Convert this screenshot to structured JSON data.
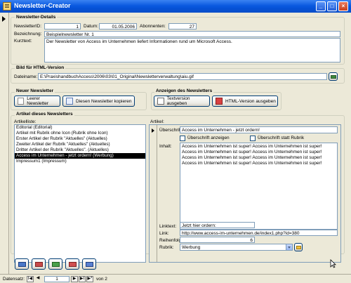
{
  "window": {
    "title": "Newsletter-Creator"
  },
  "details": {
    "section_label": "Newsletter-Details",
    "id_label": "NewsletterID:",
    "id_value": "1",
    "date_label": "Datum:",
    "date_value": "01.05.2006",
    "subscribers_label": "Abonnenten:",
    "subscribers_value": "27",
    "name_label": "Bezeichnung:",
    "name_value": "Beispielnewsletter Nr. 1",
    "short_label": "Kurztext:",
    "short_value": "Der Newsletter von Access im Unternehmen liefert Informationen rund um Microsoft Access."
  },
  "html_image": {
    "section_label": "Bild für HTML-Version",
    "file_label": "Dateiname:",
    "file_value": "E:\\PraxishandbuchAccess\\2006\\03\\01_Original\\Newsletterverwaltung\\aiu.gif"
  },
  "new_newsletter": {
    "section_label": "Neuer Newsletter",
    "empty_button": "Leerer Newsletter",
    "copy_button": "Diesen Newsletter kopieren"
  },
  "show_newsletter": {
    "section_label": "Anzeigen des Newsletters",
    "text_button": "Textversion ausgeben",
    "html_button": "HTML-Version ausgeben"
  },
  "articles": {
    "section_label": "Artikel dieses Newsletters",
    "list_label": "Artikelliste:",
    "items": [
      "Editorial (Editorial)",
      "Artikel mit Rubrik ohne Icon (Rubrik ohne Icon)",
      "Erster Artikel der Rubrik \"Aktuelles\" (Aktuelles)",
      "Zweiter Artikel der Rubrik \"Aktuelles\" (Aktuelles)",
      "Dritter Artikel der Rubrik \"Aktuelles\". (Aktuelles)",
      "Access im Unternehmen - jetzt ordern! (Werbung)",
      "Impressum1 (Impressum)"
    ],
    "selected_index": 5
  },
  "article": {
    "section_label": "Artikel:",
    "headline_label": "Überschrift:",
    "headline_value": "Access im Unternehmen - jetzt ordern!",
    "show_headline_label": "Überschrift anzeigen",
    "headline_instead_rubric_label": "Überschrift statt Rubrik",
    "content_label": "Inhalt:",
    "content_value": "Access im Unternehmen ist super! Access im Unternehmen ist super! Access im Unternehmen ist super! Access im Unternehmen ist super! Access im Unternehmen ist super! Access im Unternehmen ist super! Access im Unternehmen ist super! Access im Unternehmen ist super!",
    "linktext_label": "Linktext:",
    "linktext_value": "Jetzt hier ordern:",
    "link_label": "Link:",
    "link_value": "http://www.access-im-unternehmen.de/index1.php?id=380",
    "order_label": "Reihenfolge:",
    "order_value": "6",
    "rubric_label": "Rubrik:",
    "rubric_value": "Werbung"
  },
  "navigation": {
    "label": "Datensatz:",
    "first": "I◀",
    "prev": "◀",
    "current": "1",
    "next": "▶",
    "last": "▶I",
    "new": "▶*",
    "of_text": "von 2"
  }
}
